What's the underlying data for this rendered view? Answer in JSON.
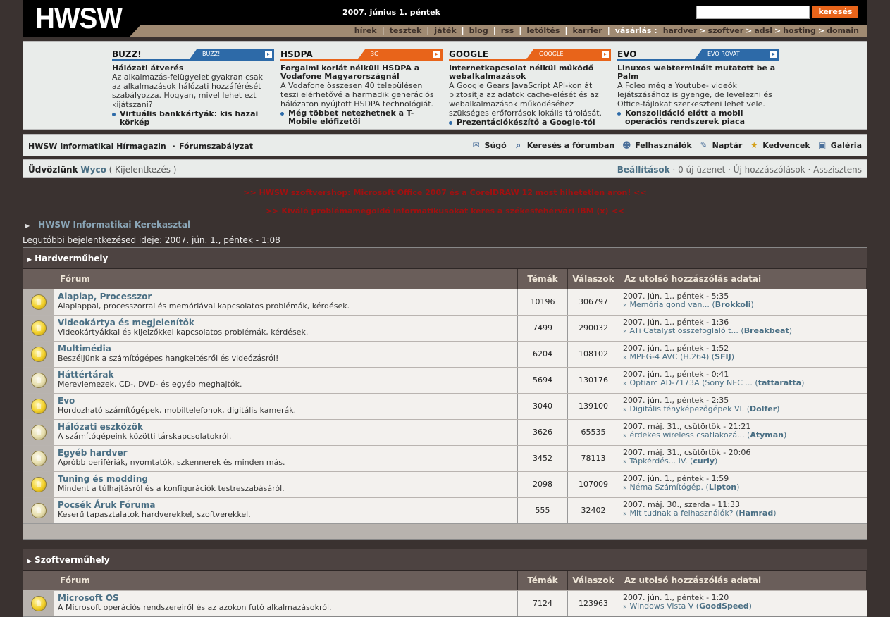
{
  "header": {
    "logo": "HWSW",
    "date": "2007. június 1. péntek",
    "search_button": "keresés",
    "nav": [
      "hírek",
      "tesztek",
      "játék",
      "blog",
      "rss",
      "letöltés",
      "karrier"
    ],
    "shop_label": "vásárlás :",
    "shop": [
      "hardver",
      "szoftver",
      "adsl",
      "hosting",
      "domain"
    ]
  },
  "news": [
    {
      "title": "BUZZ!",
      "tag": "BUZZ!",
      "headline": "Hálózati átverés",
      "body": "Az alkalmazás-felügyelet gyakran csak az alkalmazások hálózati hozzáférését szabályozza. Hogyan, mivel lehet ezt kijátszani?",
      "link": "Virtuális bankkártyák: kis hazai körkép"
    },
    {
      "title": "HSDPA",
      "tag": "3G",
      "headline": "Forgalmi korlát nélküli HSDPA a Vodafone Magyarországnál",
      "body": "A Vodafone összesen 40 települé­sen teszi elérhetővé a harmadik generációs hálózaton nyújtott HSDPA technológiát.",
      "link": "Még többet netezhetnek a T-Mobile előfizetői"
    },
    {
      "title": "GOOGLE",
      "tag": "GOOGLE",
      "headline": "Internetkapcsolat nélkül működő webalkalmazások",
      "body": "A Google Gears JavaScript API-kon át biztosítja az adatok cache-elését és az webalkalmazások működéséhez szükséges erőforrások lokális tárolását.",
      "link": "Prezentációkészítő a Google-tól"
    },
    {
      "title": "EVO",
      "tag": "EVO ROVAT",
      "headline": "Linuxos webterminált mutatott be a Palm",
      "body": "A Foleo még a Youtube- videók lejátszásához is gyenge, de levelezni és Office-fájlokat szerkeszteni lehet vele.",
      "link": "Konszolidáció előtt a mobil operációs rendszerek piaca"
    }
  ],
  "toolbar": {
    "left1": "HWSW Informatikai Hírmagazin",
    "left2": "Fórumszabályzat",
    "help": "Súgó",
    "search": "Keresés a fórumban",
    "users": "Felhasználók",
    "calendar": "Naptár",
    "favorites": "Kedvencek",
    "gallery": "Galéria"
  },
  "welcome": {
    "greeting": "Üdvözlünk",
    "user": "Wyco",
    "logout": "Kijelentkezés",
    "settings": "Beállítások",
    "new_messages": "0 új üzenet",
    "new_posts": "Új hozzászólások",
    "assistant": "Asszisztens"
  },
  "promo": [
    ">> HWSW szoftvershop: Microsoft Office 2007 és a CorelDRAW 12 most hihetetlen aron! <<",
    ">> Kiváló problémamegoldó informatikusokat keres a székesfehérvári IBM (x) <<"
  ],
  "breadcrumb": "HWSW Informatikai Kerekasztal",
  "last_login": "Legutóbbi bejelentkezésed ideje: 2007. jún. 1., péntek - 1:08",
  "columns": {
    "forum": "Fórum",
    "topics": "Témák",
    "replies": "Válaszok",
    "last": "Az utolsó hozzászólás adatai"
  },
  "sections": [
    {
      "title": "Hardverműhely",
      "forums": [
        {
          "name": "Alaplap, Processzor",
          "desc": "Alaplappal, processzorral és memóriával kapcsolatos problémák, kérdések.",
          "topics": "10196",
          "replies": "306797",
          "date": "2007. jún. 1., péntek - 5:35",
          "post": "Memória gond van...",
          "user": "Brokkoli",
          "new": true
        },
        {
          "name": "Videokártya és megjelenítők",
          "desc": "Videokártyákkal és kijelzőkkel kapcsolatos problémák, kérdések.",
          "topics": "7499",
          "replies": "290032",
          "date": "2007. jún. 1., péntek - 1:36",
          "post": "ATi Catalyst összefoglaló t...",
          "user": "Breakbeat",
          "new": true
        },
        {
          "name": "Multimédia",
          "desc": "Beszéljünk a számítógépes hangkeltésről és videózásról!",
          "topics": "6204",
          "replies": "108102",
          "date": "2007. jún. 1., péntek - 1:52",
          "post": "MPEG-4 AVC (H.264)",
          "user": "SFIJ",
          "new": true
        },
        {
          "name": "Háttértárak",
          "desc": "Merevlemezek, CD-, DVD- és egyéb meghajtók.",
          "topics": "5694",
          "replies": "130176",
          "date": "2007. jún. 1., péntek - 0:41",
          "post": "Optiarc AD-7173A (Sony NEC ...",
          "user": "tattaratta",
          "new": false
        },
        {
          "name": "Evo",
          "desc": "Hordozható számítógépek, mobiltelefonok, digitális kamerák.",
          "topics": "3040",
          "replies": "139100",
          "date": "2007. jún. 1., péntek - 2:35",
          "post": "Digitális fényképezőgépek VI.",
          "user": "Dolfer",
          "new": true
        },
        {
          "name": "Hálózati eszközök",
          "desc": "A számítógépeink közötti társkapcsolatokról.",
          "topics": "3626",
          "replies": "65535",
          "date": "2007. máj. 31., csütörtök - 21:21",
          "post": "érdekes wireless csatlakozá...",
          "user": "Atyman",
          "new": false
        },
        {
          "name": "Egyéb hardver",
          "desc": "Apróbb perifériák, nyomtatók, szkennerek és minden más.",
          "topics": "3452",
          "replies": "78113",
          "date": "2007. máj. 31., csütörtök - 20:06",
          "post": "Tápkérdés... IV.",
          "user": "curly",
          "new": false
        },
        {
          "name": "Tuning és modding",
          "desc": "Mindent a túlhajtásról és a konfigurációk testreszabásáról.",
          "topics": "2098",
          "replies": "107009",
          "date": "2007. jún. 1., péntek - 1:59",
          "post": "Néma Számítógép.",
          "user": "Lipton",
          "new": true
        },
        {
          "name": "Pocsék Áruk Fóruma",
          "desc": "Keserű tapasztalatok hardverekkel, szoftverekkel.",
          "topics": "555",
          "replies": "32402",
          "date": "2007. máj. 30., szerda - 11:33",
          "post": "Mit tudnak a felhasználók?",
          "user": "Hamrad",
          "new": false
        }
      ]
    },
    {
      "title": "Szoftverműhely",
      "forums": [
        {
          "name": "Microsoft OS",
          "desc": "A Microsoft operációs rendszereiről és az azokon futó alkalmazásokról.",
          "topics": "7124",
          "replies": "123963",
          "date": "2007. jún. 1., péntek - 1:20",
          "post": "Windows Vista V",
          "user": "GoodSpeed",
          "new": true
        }
      ]
    }
  ]
}
